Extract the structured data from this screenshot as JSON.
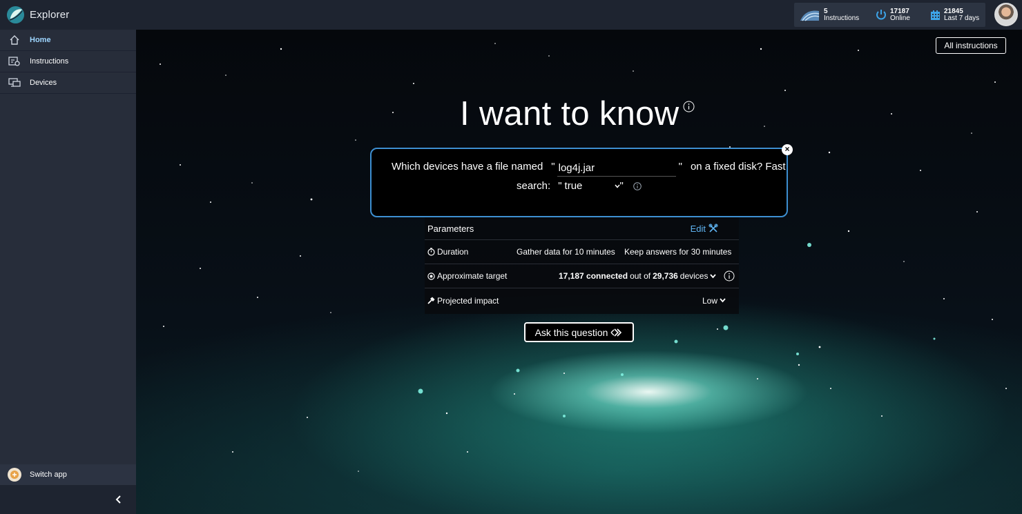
{
  "app": {
    "title": "Explorer"
  },
  "stats": {
    "instructions": {
      "count": "5",
      "label": "Instructions"
    },
    "online": {
      "count": "17187",
      "label": "Online"
    },
    "recent": {
      "count": "21845",
      "label": "Last 7 days"
    }
  },
  "sidebar": {
    "items": [
      {
        "label": "Home",
        "icon": "home-icon",
        "active": true
      },
      {
        "label": "Instructions",
        "icon": "instructions-icon",
        "active": false
      },
      {
        "label": "Devices",
        "icon": "devices-icon",
        "active": false
      }
    ],
    "switch_app": "Switch app"
  },
  "main": {
    "all_instructions": "All instructions",
    "headline": "I want to know",
    "question": {
      "prefix": "Which devices have a file named",
      "file_value": "log4j.jar",
      "middle": "on a fixed disk? Fast",
      "search_label": "search:",
      "search_value": "true",
      "quote": "\""
    },
    "parameters": {
      "title": "Parameters",
      "edit": "Edit",
      "duration_label": "Duration",
      "gather": "Gather data for 10 minutes",
      "keep": "Keep answers for 30 minutes",
      "target_label": "Approximate target",
      "connected_count": "17,187 connected",
      "out_of": "out of",
      "total": "29,736",
      "devices": "devices",
      "impact_label": "Projected impact",
      "impact_value": "Low"
    },
    "ask_button": "Ask this question"
  },
  "colors": {
    "accent": "#3d8fd1",
    "link": "#5fb4f2",
    "sidebar": "#272d3a",
    "topbar": "#1e2430",
    "active_nav": "#9ed6ff"
  }
}
